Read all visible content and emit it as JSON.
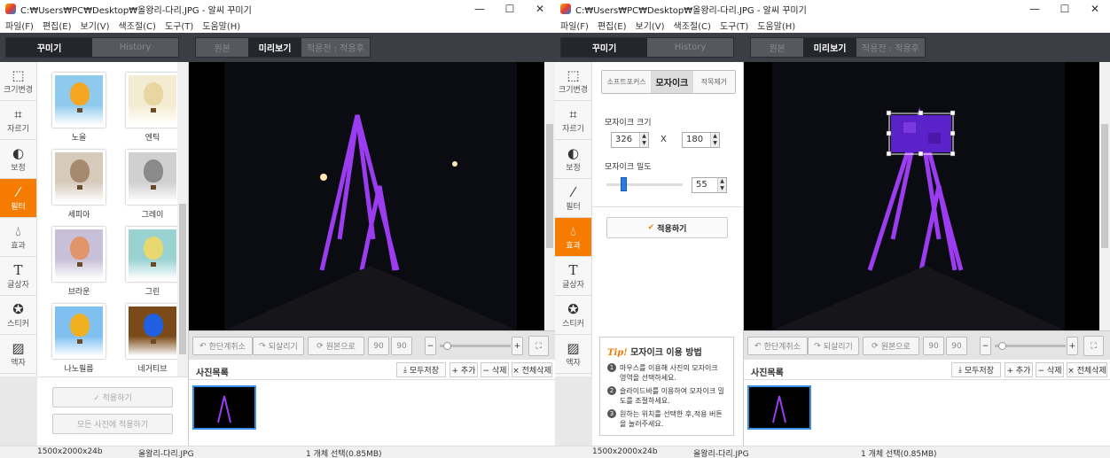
{
  "window_title": "C:₩Users₩PC₩Desktop₩올왕리-다리.JPG - 알씨 꾸미기",
  "window_controls": {
    "minimize": "—",
    "maximize": "☐",
    "close": "✕"
  },
  "menu": [
    "파일(F)",
    "편집(E)",
    "보기(V)",
    "색조절(C)",
    "도구(T)",
    "도움말(H)"
  ],
  "panel_tabs": [
    "꾸미기",
    "History"
  ],
  "view_tabs": [
    "원본",
    "미리보기",
    "적용전 : 적용후"
  ],
  "sidebar": [
    "크기변경",
    "자르기",
    "보정",
    "필터",
    "효과",
    "글상자",
    "스티커",
    "액자"
  ],
  "filters": [
    {
      "label": "노을",
      "color": "#f5a623",
      "bg": "#8ec9ee"
    },
    {
      "label": "엔틱",
      "color": "#e8d6a0",
      "bg": "#f4ecd2"
    },
    {
      "label": "세피아",
      "color": "#a68a70",
      "bg": "#d6cabb"
    },
    {
      "label": "그레이",
      "color": "#8a8a8a",
      "bg": "#d0d0d0"
    },
    {
      "label": "브라운",
      "color": "#e0956a",
      "bg": "#c8c0d8"
    },
    {
      "label": "그린",
      "color": "#e8d870",
      "bg": "#9ad2d2"
    },
    {
      "label": "나노필름",
      "color": "#f0b020",
      "bg": "#7fc0f0"
    },
    {
      "label": "네거티브",
      "color": "#2060e0",
      "bg": "#7a4a18"
    }
  ],
  "left_buttons": {
    "apply": "✓ 적용하기",
    "apply_all": "모든 사진에 적용하기"
  },
  "toolbar": {
    "undo": "한단계취소",
    "redo": "되살리기",
    "original": "원본으로",
    "rot_left": "90",
    "rot_right": "90",
    "zoom_out": "−",
    "zoom_in": "+",
    "zoom_level": 0.05
  },
  "photo_list": {
    "title": "사진목록",
    "save_all": "모두저장",
    "add": "+ 추가",
    "delete": "− 삭제",
    "delete_all": "× 전체삭제"
  },
  "status": {
    "dimensions": "1500x2000x24b",
    "filename": "올왕리-다리.JPG",
    "selection": "1 개체 선택(0.85MB)"
  },
  "mosaic": {
    "tabs": [
      "소프트포커스",
      "모자이크",
      "적목제거"
    ],
    "size_label": "모자이크 크기",
    "width": "326",
    "x_sep": "X",
    "height": "180",
    "density_label": "모자이크 밀도",
    "density": "55",
    "apply": "적용하기",
    "tip_prefix": "Tip!",
    "tip_title": "모자이크 이용 방법",
    "tip_steps": [
      {
        "n": "1",
        "text": "마우스를 이용해 사진의 모자이크 영역을 선택하세요."
      },
      {
        "n": "2",
        "text": "슬라이드바를 이용하여 모자이크 밀도를 조절하세요."
      },
      {
        "n": "3",
        "text": "원하는 위치를 선택한 후,적용 버튼을 눌러주세요."
      }
    ]
  },
  "colors": {
    "accent": "#f57c00",
    "dark": "#3b3e45",
    "bridge": "#9b3cf0"
  }
}
